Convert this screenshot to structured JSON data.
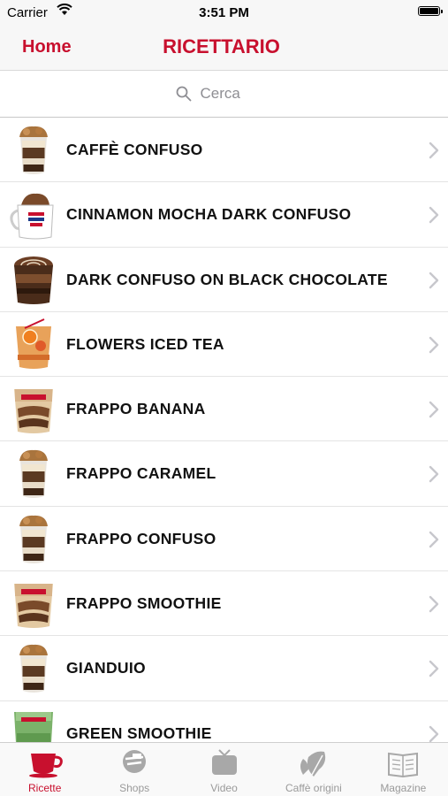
{
  "status_bar": {
    "carrier": "Carrier",
    "time": "3:51 PM"
  },
  "nav": {
    "back_label": "Home",
    "title": "RICETTARIO"
  },
  "search": {
    "placeholder": "Cerca"
  },
  "recipes": [
    {
      "name": "CAFFÈ CONFUSO",
      "thumb": "cup"
    },
    {
      "name": "CINNAMON MOCHA DARK CONFUSO",
      "thumb": "mug"
    },
    {
      "name": "DARK CONFUSO ON BLACK CHOCOLATE",
      "thumb": "dark"
    },
    {
      "name": "FLOWERS ICED TEA",
      "thumb": "tea"
    },
    {
      "name": "FRAPPO BANANA",
      "thumb": "frappo"
    },
    {
      "name": "FRAPPO CARAMEL",
      "thumb": "cup"
    },
    {
      "name": "FRAPPO CONFUSO",
      "thumb": "cup"
    },
    {
      "name": "FRAPPO SMOOTHIE",
      "thumb": "frappo"
    },
    {
      "name": "GIANDUIO",
      "thumb": "cup"
    },
    {
      "name": "GREEN SMOOTHIE",
      "thumb": "green"
    }
  ],
  "tabs": [
    {
      "label": "Ricette",
      "icon": "cup-icon",
      "active": true
    },
    {
      "label": "Shops",
      "icon": "shops-icon",
      "active": false
    },
    {
      "label": "Video",
      "icon": "tv-icon",
      "active": false
    },
    {
      "label": "Caffè origini",
      "icon": "leaf-icon",
      "active": false
    },
    {
      "label": "Magazine",
      "icon": "magazine-icon",
      "active": false
    }
  ],
  "colors": {
    "accent": "#c8102e",
    "tab_inactive": "#9a9a9a"
  }
}
